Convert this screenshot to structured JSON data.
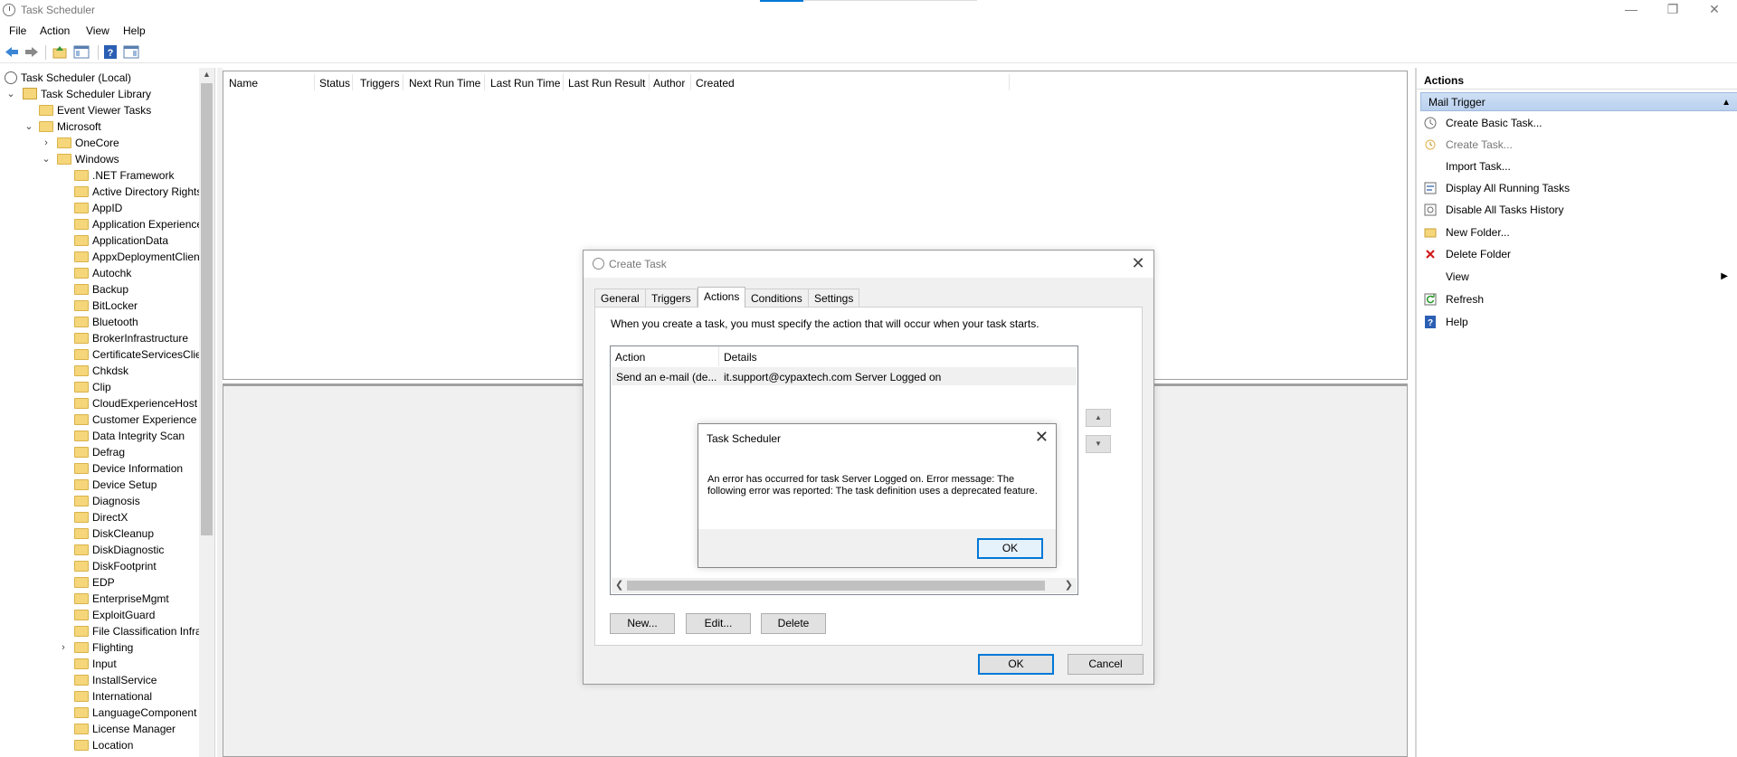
{
  "window": {
    "title": "Task Scheduler"
  },
  "menu": [
    "File",
    "Action",
    "View",
    "Help"
  ],
  "tree": {
    "root": "Task Scheduler (Local)",
    "library": "Task Scheduler Library",
    "event_viewer": "Event Viewer Tasks",
    "microsoft": "Microsoft",
    "onecore": "OneCore",
    "windows": "Windows",
    "items": [
      ".NET Framework",
      "Active Directory Rights",
      "AppID",
      "Application Experience",
      "ApplicationData",
      "AppxDeploymentClient",
      "Autochk",
      "Backup",
      "BitLocker",
      "Bluetooth",
      "BrokerInfrastructure",
      "CertificateServicesClie",
      "Chkdsk",
      "Clip",
      "CloudExperienceHost",
      "Customer Experience I",
      "Data Integrity Scan",
      "Defrag",
      "Device Information",
      "Device Setup",
      "Diagnosis",
      "DirectX",
      "DiskCleanup",
      "DiskDiagnostic",
      "DiskFootprint",
      "EDP",
      "EnterpriseMgmt",
      "ExploitGuard",
      "File Classification Infra",
      "Flighting",
      "Input",
      "InstallService",
      "International",
      "LanguageComponent",
      "License Manager",
      "Location"
    ]
  },
  "task_list": {
    "columns": [
      "Name",
      "Status",
      "Triggers",
      "Next Run Time",
      "Last Run Time",
      "Last Run Result",
      "Author",
      "Created"
    ]
  },
  "actions_panel": {
    "header": "Actions",
    "section": "Mail Trigger",
    "items": [
      "Create Basic Task...",
      "Create Task...",
      "Import Task...",
      "Display All Running Tasks",
      "Disable All Tasks History",
      "New Folder...",
      "Delete Folder",
      "View",
      "Refresh",
      "Help"
    ]
  },
  "create_task": {
    "title": "Create Task",
    "tabs": [
      "General",
      "Triggers",
      "Actions",
      "Conditions",
      "Settings"
    ],
    "active_tab": "Actions",
    "description": "When you create a task, you must specify the action that will occur when your task starts.",
    "list_headers": [
      "Action",
      "Details"
    ],
    "row": {
      "action": "Send an e-mail (de...",
      "details": "it.support@cypaxtech.com Server Logged on"
    },
    "buttons": {
      "new": "New...",
      "edit": "Edit...",
      "delete": "Delete",
      "ok": "OK",
      "cancel": "Cancel"
    }
  },
  "error_box": {
    "title": "Task Scheduler",
    "message": "An error has occurred for task Server Logged on. Error message: The following error was reported: The task definition uses a deprecated feature.",
    "ok": "OK"
  },
  "colors": {
    "accent": "#0078d7",
    "section_bg": "#c4d8f2",
    "folder": "#f5d67a"
  }
}
